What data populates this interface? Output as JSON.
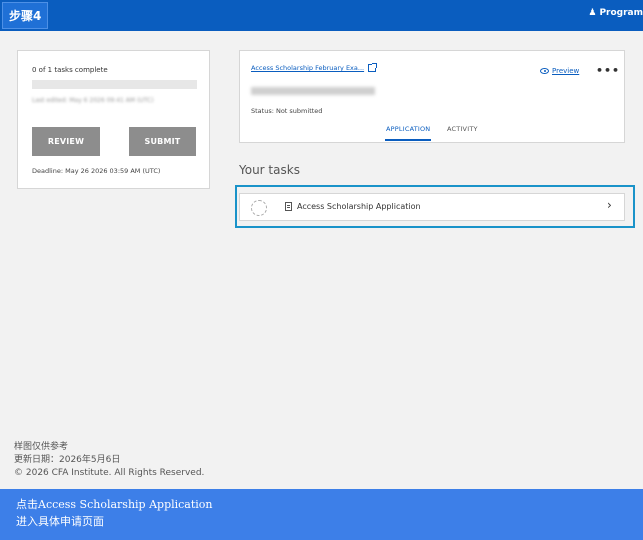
{
  "header": {
    "step_label": "步骤4",
    "programs_label": "Program"
  },
  "progress_card": {
    "tasks_complete": "0 of 1 tasks complete",
    "progress_fraction": 0,
    "last_edited": "Last edited: May 6 2026 09:41 AM (UTC)",
    "review_label": "REVIEW",
    "submit_label": "SUBMIT",
    "deadline": "Deadline: May 26 2026 03:59 AM (UTC)"
  },
  "application_card": {
    "title": "Access Scholarship February Exa...",
    "preview_label": "Preview",
    "more_label": "•••",
    "application_id": "ACCESSEPZT-00000000000",
    "status": "Status: Not submitted",
    "tabs": [
      {
        "label": "APPLICATION",
        "active": true
      },
      {
        "label": "ACTIVITY",
        "active": false
      }
    ]
  },
  "tasks_section": {
    "heading": "Your tasks",
    "tasks": [
      {
        "label": "Access Scholarship Application"
      }
    ]
  },
  "footer": {
    "line1": "样图仅供参考",
    "line2": "更新日期：2026年5月6日",
    "copyright": "© 2026 CFA Institute. All Rights Reserved."
  },
  "instruction_banner": {
    "line1": "点击Access Scholarship Application",
    "line2": "进入具体申请页面"
  },
  "colors": {
    "brand_blue": "#0a5dbf",
    "banner_blue": "#3d7fe8",
    "highlight": "#1a93c9",
    "button_gray": "#8d8d8d"
  }
}
